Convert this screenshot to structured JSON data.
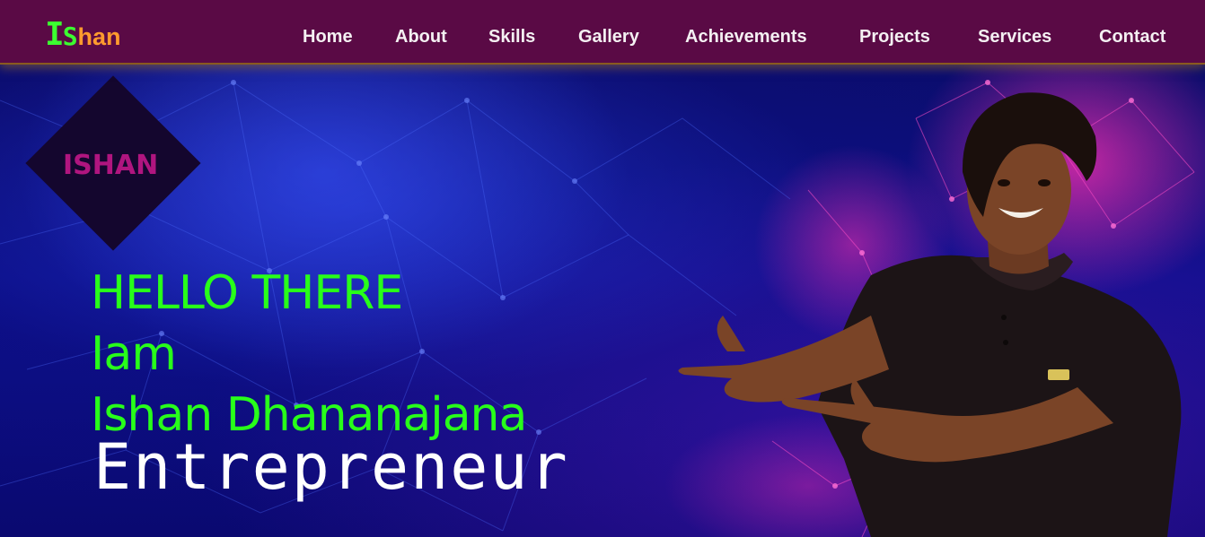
{
  "logo": {
    "part1": "I",
    "part2": "S",
    "part3": "han"
  },
  "nav": {
    "items": [
      {
        "id": "home",
        "label": "Home"
      },
      {
        "id": "about",
        "label": "About"
      },
      {
        "id": "skills",
        "label": "Skills"
      },
      {
        "id": "gallery",
        "label": "Gallery"
      },
      {
        "id": "achievements",
        "label": "Achievements"
      },
      {
        "id": "projects",
        "label": "Projects"
      },
      {
        "id": "services",
        "label": "Services"
      },
      {
        "id": "contact",
        "label": "Contact"
      }
    ]
  },
  "hero": {
    "badge": "ISHAN",
    "line1": "HELLO THERE",
    "line2": "Iam",
    "line3": "Ishan Dhananajana",
    "role": "Entrepreneur"
  },
  "colors": {
    "navbar": "#5a0a45",
    "logo_green": "#3cff30",
    "logo_orange": "#ff9b2e",
    "greeting_green": "#28ff1a",
    "badge_text": "#b0157f"
  }
}
